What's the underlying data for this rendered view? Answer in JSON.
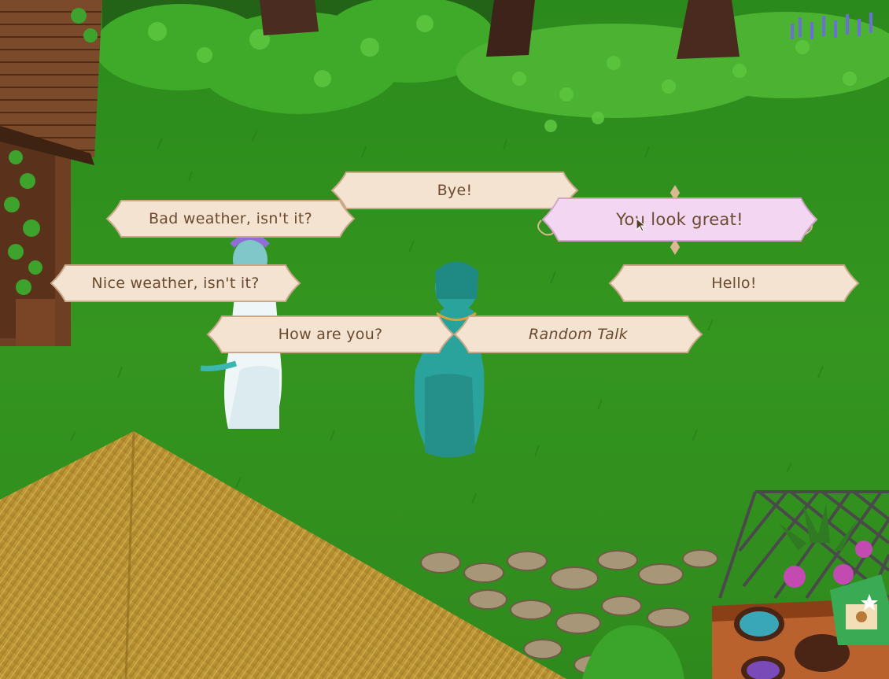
{
  "dialogue": {
    "options": [
      {
        "id": "bye",
        "label": "Bye!",
        "selected": false
      },
      {
        "id": "bad-weather",
        "label": "Bad weather, isn't it?",
        "selected": false
      },
      {
        "id": "you-look-great",
        "label": "You look great!",
        "selected": true
      },
      {
        "id": "nice-weather",
        "label": "Nice weather, isn't it?",
        "selected": false
      },
      {
        "id": "hello",
        "label": "Hello!",
        "selected": false
      },
      {
        "id": "how-are-you",
        "label": "How are you?",
        "selected": false
      },
      {
        "id": "random-talk",
        "label": "Random Talk",
        "selected": false
      }
    ]
  },
  "colors": {
    "panel": "#f3e3d0",
    "panel_border": "#c9a98a",
    "selected_panel": "#f3d6f2",
    "text": "#6a4a30",
    "grass": "#2f8a1f"
  }
}
